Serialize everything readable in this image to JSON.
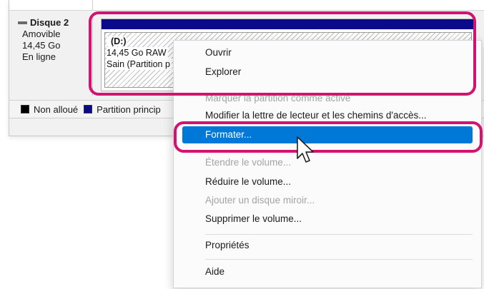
{
  "disk": {
    "name": "Disque 2",
    "type": "Amovible",
    "size": "14,45 Go",
    "status": "En ligne"
  },
  "volume": {
    "label": "(D:)",
    "size_fs": "14,45 Go RAW",
    "health": "Sain (Partition p"
  },
  "legend": {
    "items": [
      {
        "label": "Non alloué",
        "color": "#000000"
      },
      {
        "label": "Partition princip",
        "color": "#0a0a8a"
      }
    ]
  },
  "context_menu": {
    "items": [
      {
        "label": "Ouvrir",
        "enabled": true
      },
      {
        "label": "Explorer",
        "enabled": true
      },
      {
        "label": "Marquer la partition comme active",
        "enabled": false
      },
      {
        "label": "Modifier la lettre de lecteur et les chemins d'accès...",
        "enabled": true
      },
      {
        "label": "Formater...",
        "enabled": true,
        "selected": true
      },
      {
        "label": "Étendre le volume...",
        "enabled": false
      },
      {
        "label": "Réduire le volume...",
        "enabled": true
      },
      {
        "label": "Ajouter un disque miroir...",
        "enabled": false
      },
      {
        "label": "Supprimer le volume...",
        "enabled": true
      },
      {
        "label": "Propriétés",
        "enabled": true
      },
      {
        "label": "Aide",
        "enabled": true
      }
    ]
  },
  "colors": {
    "highlight": "#d3136f",
    "selection": "#0078d7",
    "partition_primary": "#0a0a8a"
  },
  "icons": {
    "disk": "disk-icon",
    "cursor": "mouse-pointer-icon"
  }
}
